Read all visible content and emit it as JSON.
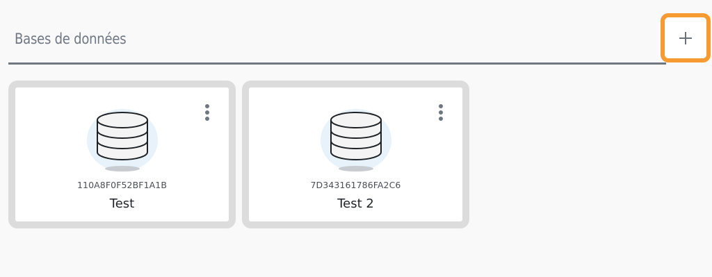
{
  "header": {
    "title": "Bases de données",
    "add_button_icon": "plus-icon",
    "add_button_highlight_color": "#f79a32"
  },
  "databases": [
    {
      "id": "110A8F0F52BF1A1B",
      "name": "Test",
      "icon": "database-icon",
      "menu_icon": "more-vertical-icon"
    },
    {
      "id": "7D343161786FA2C6",
      "name": "Test 2",
      "icon": "database-icon",
      "menu_icon": "more-vertical-icon"
    }
  ],
  "colors": {
    "background": "#f9f9f9",
    "card_border": "#dcdcdc",
    "icon_circle": "#e8f2fa",
    "header_text": "#6e7783"
  }
}
